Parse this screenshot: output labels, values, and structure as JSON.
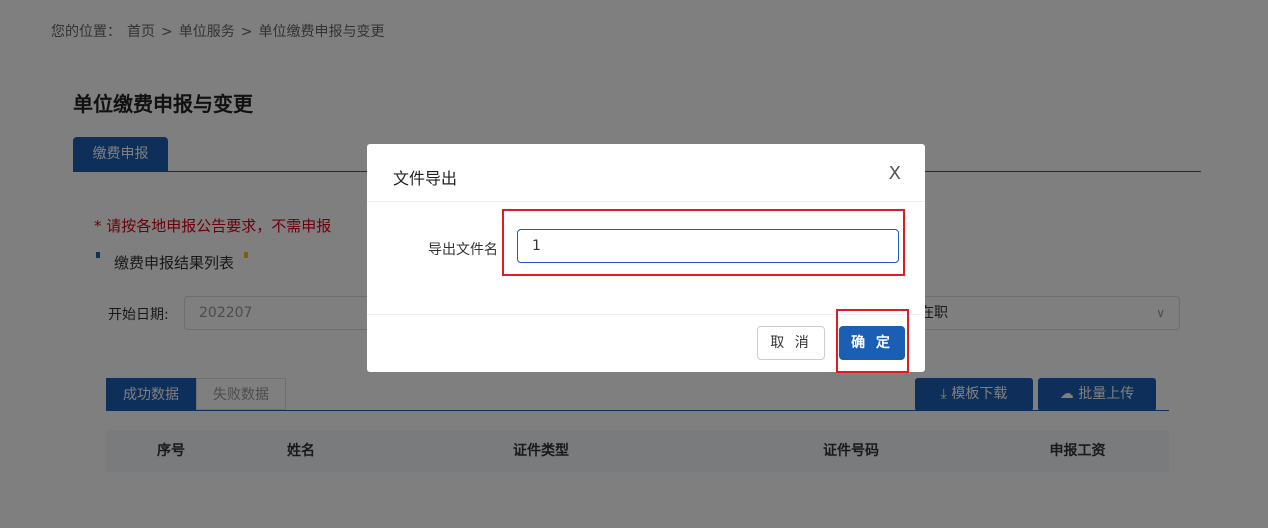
{
  "breadcrumb": {
    "prefix": "您的位置：",
    "items": [
      "首页",
      "单位服务",
      "单位缴费申报与变更"
    ],
    "sep": ">"
  },
  "page": {
    "title": "单位缴费申报与变更",
    "main_tab": "缴费申报",
    "notice": "* 请按各地申报公告要求，不需申报",
    "section_title": "缴费申报结果列表",
    "date_label": "开始日期:",
    "date_value": "202207",
    "status_value": "在职"
  },
  "data_tabs": [
    "成功数据",
    "失败数据"
  ],
  "buttons": {
    "download": "模板下载",
    "upload": "批量上传"
  },
  "table": {
    "columns": [
      "序号",
      "姓名",
      "证件类型",
      "证件号码",
      "申报工资"
    ]
  },
  "modal": {
    "title": "文件导出",
    "close": "X",
    "field_label": "导出文件名",
    "field_value": "1",
    "cancel": "取 消",
    "ok": "确 定"
  },
  "colors": {
    "primary": "#1a5fb4",
    "highlight": "#e01b24",
    "notice": "#d9001b"
  }
}
